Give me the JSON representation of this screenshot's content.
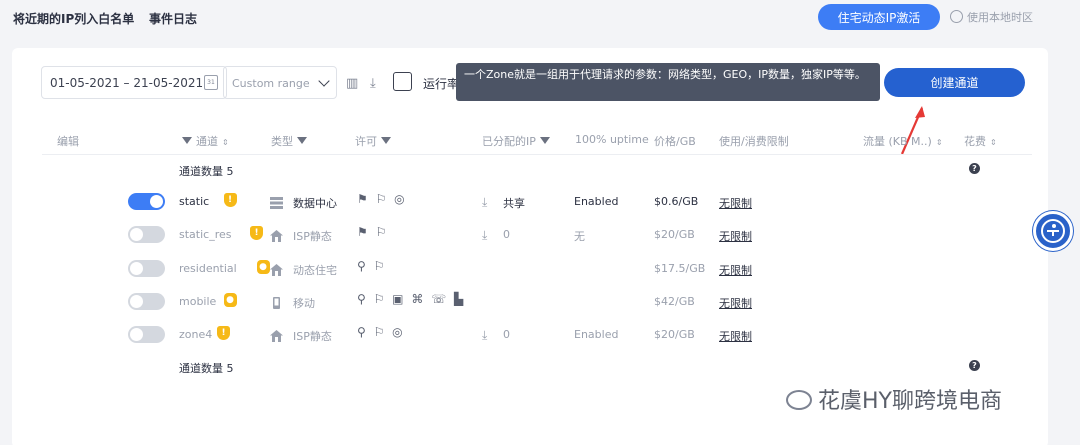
{
  "top": {
    "whitelist_link": "将近期的IP列入白名单",
    "event_log_link": "事件日志",
    "activate_button": "住宅动态IP激活",
    "local_tz": "使用本地时区"
  },
  "toolbar": {
    "date_range": "01-05-2021 – 21-05-2021",
    "calendar_num": "31",
    "custom_range_placeholder": "Custom range",
    "run_label": "运行率",
    "tooltip": "一个Zone就是一组用于代理请求的参数：网络类型，GEO，IP数量，独家IP等等。",
    "create_button": "创建通道"
  },
  "columns": {
    "edit": "编辑",
    "channel": "通道",
    "type": "类型",
    "permit": "许可",
    "assigned_ip": "已分配的IP",
    "uptime": "100% uptime",
    "price": "价格/GB",
    "usage_limit": "使用/消费限制",
    "traffic": "流量 (KB M..)",
    "cost": "花费"
  },
  "summary": {
    "count_label": "通道数量 5"
  },
  "zones": [
    {
      "name": "static",
      "enabled": true,
      "badge": "shield",
      "type": "数据中心",
      "type_icon": "server-icon",
      "permits": "⚑ ⚐ ◎",
      "assigned": "共享",
      "show_download": true,
      "uptime": "Enabled",
      "price": "$0.6/GB",
      "limit": "无限制"
    },
    {
      "name": "static_res",
      "enabled": false,
      "badge": "shield",
      "type": "ISP静态",
      "type_icon": "home-icon",
      "permits": "⚑ ⚐",
      "assigned": "0",
      "show_download": true,
      "uptime": "无",
      "price": "$20/GB",
      "limit": "无限制"
    },
    {
      "name": "residential",
      "enabled": false,
      "badge": "lock",
      "type": "动态住宅",
      "type_icon": "home-icon",
      "permits": "⚲ ⚐",
      "assigned": "",
      "show_download": false,
      "uptime": "",
      "price": "$17.5/GB",
      "limit": "无限制"
    },
    {
      "name": "mobile",
      "enabled": false,
      "badge": "lock",
      "type": "移动",
      "type_icon": "phone-icon",
      "permits": "⚲ ⚐ ▣ ⌘ ☏ ▙",
      "assigned": "",
      "show_download": false,
      "uptime": "",
      "price": "$42/GB",
      "limit": "无限制"
    },
    {
      "name": "zone4",
      "enabled": false,
      "badge": "shield",
      "type": "ISP静态",
      "type_icon": "home-icon",
      "permits": "⚲ ⚐ ◎",
      "assigned": "0",
      "show_download": true,
      "uptime": "Enabled",
      "price": "$20/GB",
      "limit": "无限制"
    }
  ],
  "watermark": "花虞HY聊跨境电商",
  "colors": {
    "accent": "#3d7df5",
    "primary_button": "#2561d0",
    "badge": "#f6b917",
    "tooltip_bg": "#4c5465"
  }
}
